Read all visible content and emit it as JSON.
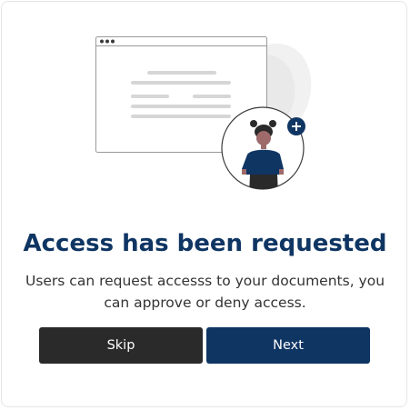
{
  "dialog": {
    "title": "Access has been requested",
    "description": "Users can request accesss to your documents, you can approve or deny access.",
    "skip_label": "Skip",
    "next_label": "Next"
  },
  "illustration": {
    "icons": [
      "browser-window-illustration",
      "person-avatar-illustration",
      "plus-icon"
    ]
  },
  "colors": {
    "primary": "#0f3563",
    "secondary_button": "#2a2a2a",
    "text": "#333333"
  }
}
